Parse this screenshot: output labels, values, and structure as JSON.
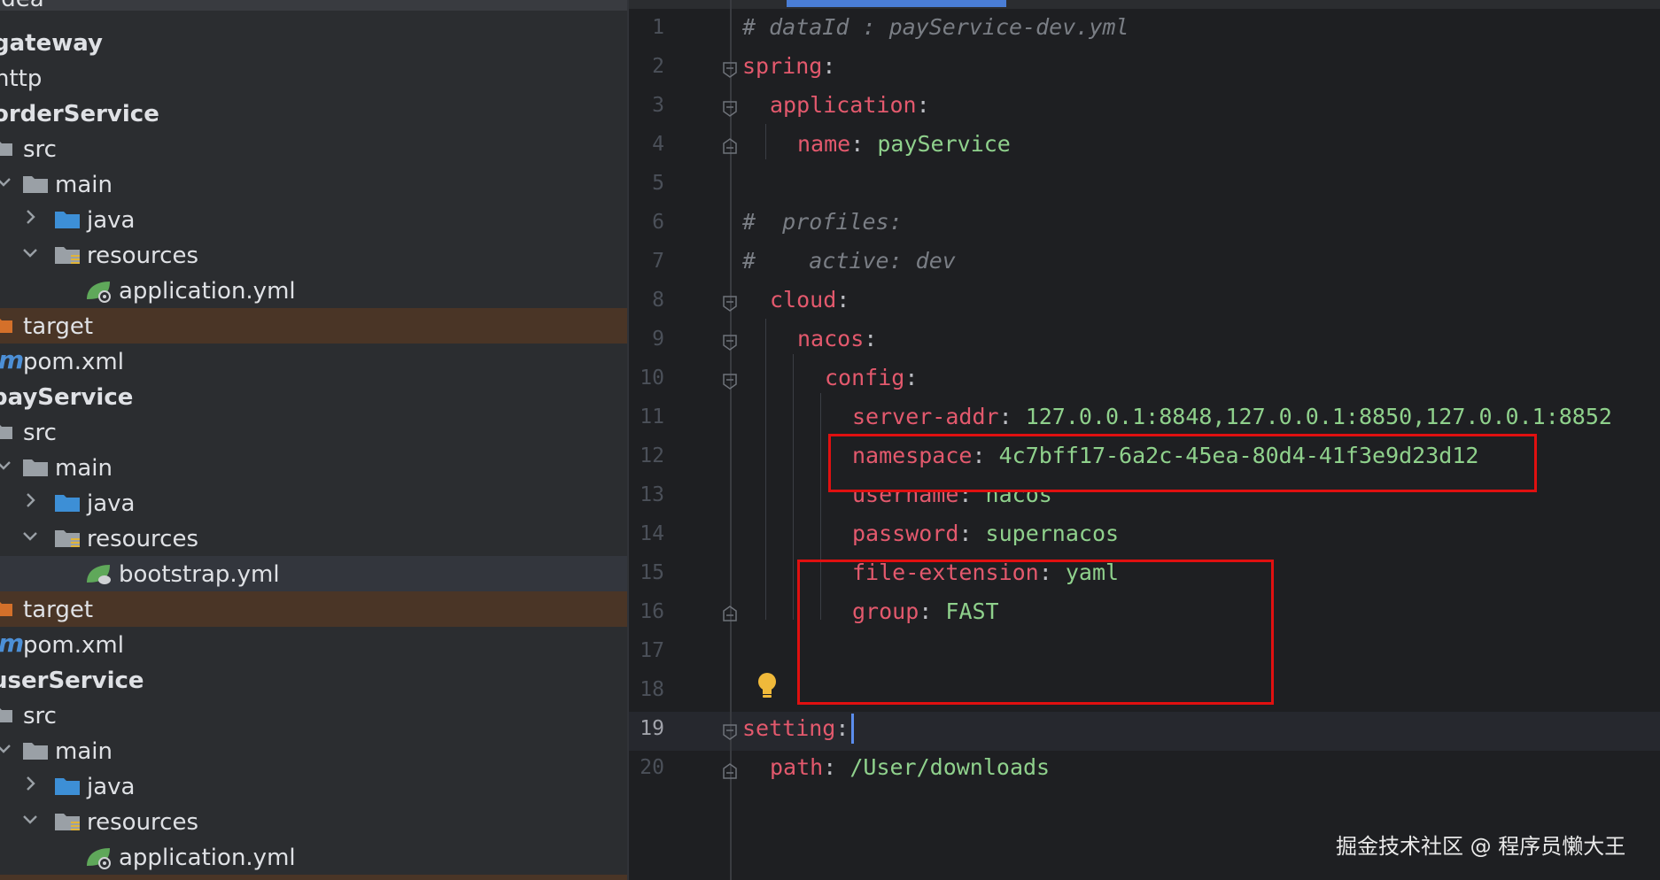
{
  "project_tree": {
    "rows": [
      {
        "label": "idea"
      },
      {
        "label": "gateway"
      },
      {
        "label": "http"
      },
      {
        "label": "orderService"
      },
      {
        "label": "src"
      },
      {
        "label": "main"
      },
      {
        "label": "java"
      },
      {
        "label": "resources"
      },
      {
        "label": "application.yml"
      },
      {
        "label": "target"
      },
      {
        "label": "pom.xml"
      },
      {
        "label": "payService"
      },
      {
        "label": "src"
      },
      {
        "label": "main"
      },
      {
        "label": "java"
      },
      {
        "label": "resources"
      },
      {
        "label": "bootstrap.yml"
      },
      {
        "label": "target"
      },
      {
        "label": "pom.xml"
      },
      {
        "label": "userService"
      },
      {
        "label": "src"
      },
      {
        "label": "main"
      },
      {
        "label": "java"
      },
      {
        "label": "resources"
      },
      {
        "label": "application.yml"
      }
    ]
  },
  "editor": {
    "line_numbers": [
      "1",
      "2",
      "3",
      "4",
      "5",
      "6",
      "7",
      "8",
      "9",
      "10",
      "11",
      "12",
      "13",
      "14",
      "15",
      "16",
      "17",
      "18",
      "19",
      "20"
    ],
    "current_line": "19",
    "lines": {
      "l1": "# dataId : payService-dev.yml",
      "l2_key": "spring",
      "l3_key": "application",
      "l4_key": "name",
      "l4_val": "payService",
      "l6": "#  profiles:",
      "l7": "#    active: dev",
      "l8_key": "cloud",
      "l9_key": "nacos",
      "l10_key": "config",
      "l11_key": "server-addr",
      "l11_val": "127.0.0.1:8848,127.0.0.1:8850,127.0.0.1:8852",
      "l12_key": "namespace",
      "l12_val": "4c7bff17-6a2c-45ea-80d4-41f3e9d23d12",
      "l13_key": "username",
      "l13_val": "nacos",
      "l14_key": "password",
      "l14_val": "supernacos",
      "l15_key": "file-extension",
      "l15_val": "yaml",
      "l16_key": "group",
      "l16_val": "FAST",
      "l19_key": "setting",
      "l20_key": "path",
      "l20_val": "/User/downloads"
    },
    "colon": ":"
  },
  "watermark": "掘金技术社区 @ 程序员懒大王",
  "colors": {
    "key": "#e3596d",
    "value": "#8fd18c",
    "comment": "#7a7e85",
    "annotation_box": "#e01010",
    "tab_indicator": "#4a7ed6"
  }
}
